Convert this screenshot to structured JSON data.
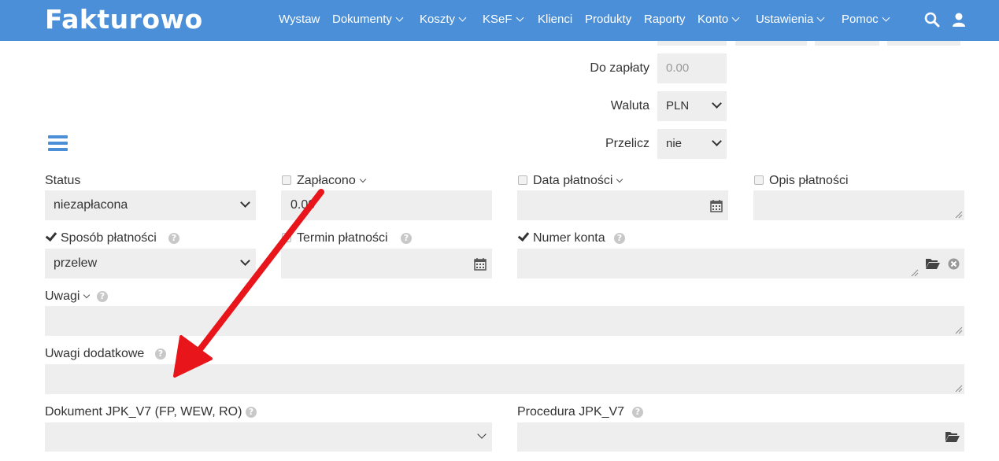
{
  "app": {
    "logo": "Fakturowo"
  },
  "nav": [
    {
      "label": "Wystaw",
      "dropdown": false
    },
    {
      "label": "Dokumenty",
      "dropdown": true
    },
    {
      "label": "Koszty",
      "dropdown": true
    },
    {
      "label": "KSeF",
      "dropdown": true
    },
    {
      "label": "Klienci",
      "dropdown": false
    },
    {
      "label": "Produkty",
      "dropdown": false
    },
    {
      "label": "Raporty",
      "dropdown": false
    },
    {
      "label": "Konto",
      "dropdown": true
    },
    {
      "label": "Ustawienia",
      "dropdown": true
    },
    {
      "label": "Pomoc",
      "dropdown": true
    }
  ],
  "header_icons": [
    "search-icon",
    "user-icon"
  ],
  "summary": {
    "do_zaplaty_label": "Do zapłaty",
    "do_zaplaty_value": "0.00",
    "waluta_label": "Waluta",
    "waluta_value": "PLN",
    "przelicz_label": "Przelicz",
    "przelicz_value": "nie"
  },
  "form": {
    "status_label": "Status",
    "status_value": "niezapłacona",
    "zaplacono_label": "Zapłacono",
    "zaplacono_value": "0.00",
    "zaplacono_checked": false,
    "data_platnosci_label": "Data płatności",
    "data_platnosci_checked": false,
    "opis_platnosci_label": "Opis płatności",
    "opis_platnosci_checked": false,
    "sposob_platnosci_label": "Sposób płatności",
    "sposob_platnosci_checked": true,
    "sposob_platnosci_value": "przelew",
    "termin_platnosci_label": "Termin płatności",
    "numer_konta_label": "Numer konta",
    "numer_konta_checked": true,
    "uwagi_label": "Uwagi",
    "uwagi_dodatkowe_label": "Uwagi dodatkowe",
    "jpk_dokument_label": "Dokument JPK_V7 (FP, WEW, RO)",
    "jpk_procedura_label": "Procedura JPK_V7"
  },
  "colors": {
    "header": "#4a8fd8",
    "field_bg": "#eeeeee",
    "arrow": "#e8151b"
  }
}
